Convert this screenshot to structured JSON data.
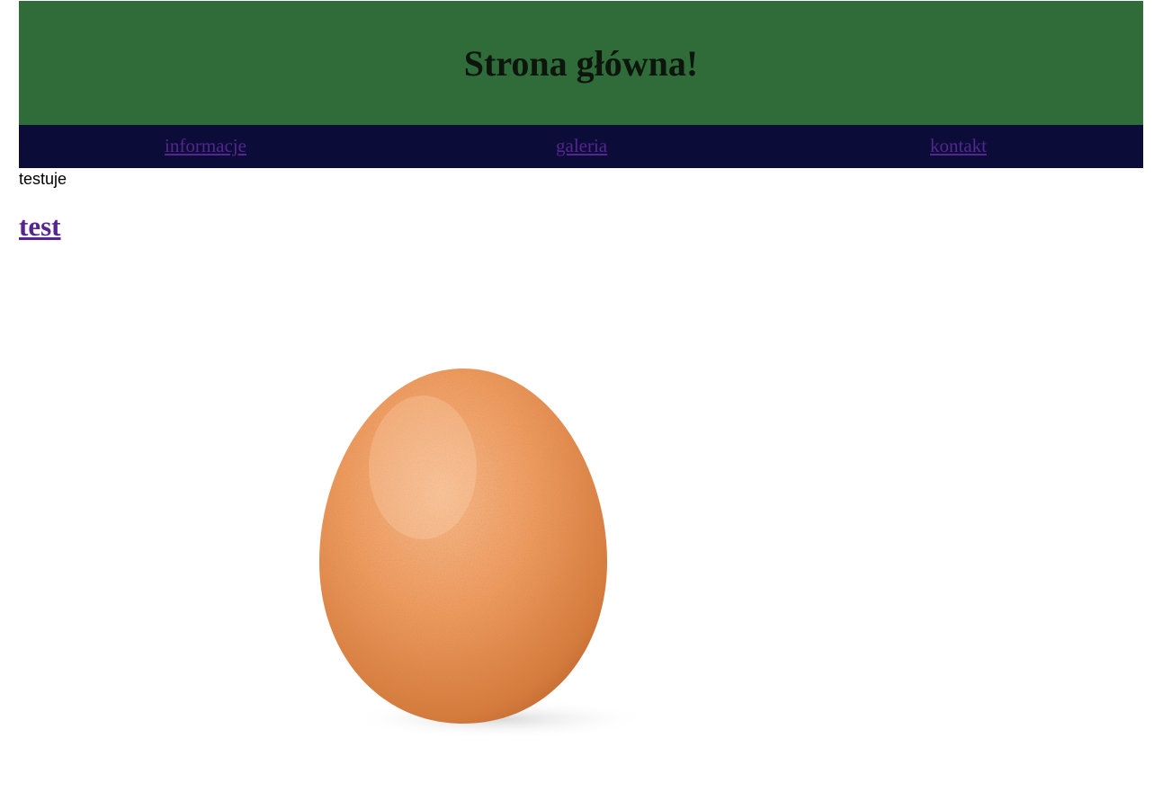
{
  "header": {
    "title": "Strona główna!",
    "background_color": "#306b3a",
    "title_color": "#0c160c"
  },
  "nav": {
    "background_color": "#0b0d38",
    "link_color": "#552592",
    "items": [
      {
        "label": "informacje"
      },
      {
        "label": "galeria"
      },
      {
        "label": "kontakt"
      }
    ]
  },
  "main": {
    "intro_text": "testuje",
    "heading_link": "test",
    "image": {
      "subject": "brown egg on white background",
      "icon": "egg-image"
    }
  }
}
